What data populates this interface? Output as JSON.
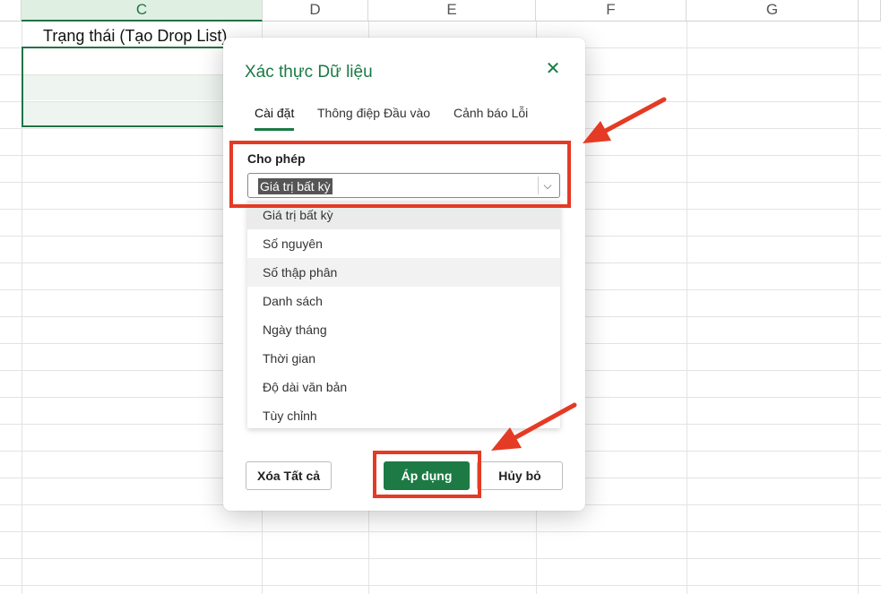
{
  "sheet": {
    "columns": [
      {
        "label": "C",
        "active": true
      },
      {
        "label": "D",
        "active": false
      },
      {
        "label": "E",
        "active": false
      },
      {
        "label": "F",
        "active": false
      },
      {
        "label": "G",
        "active": false
      }
    ],
    "cell_c1_text": "Trạng thái (Tạo Drop List)"
  },
  "dialog": {
    "title": "Xác thực Dữ liệu",
    "close_icon": "close-icon",
    "tabs": [
      "Cài đặt",
      "Thông điệp Đầu vào",
      "Cảnh báo Lỗi"
    ],
    "active_tab": "Cài đặt",
    "allow": {
      "label": "Cho phép",
      "value": "Giá trị bất kỳ",
      "options": [
        "Giá trị bất kỳ",
        "Số nguyên",
        "Số thập phân",
        "Danh sách",
        "Ngày tháng",
        "Thời gian",
        "Độ dài văn bản",
        "Tùy chỉnh"
      ]
    },
    "buttons": {
      "clear_all": "Xóa Tất cả",
      "apply": "Áp dụng",
      "cancel": "Hủy bỏ"
    }
  },
  "colors": {
    "accent": "#1d7a45",
    "annotation": "#e53a24"
  }
}
